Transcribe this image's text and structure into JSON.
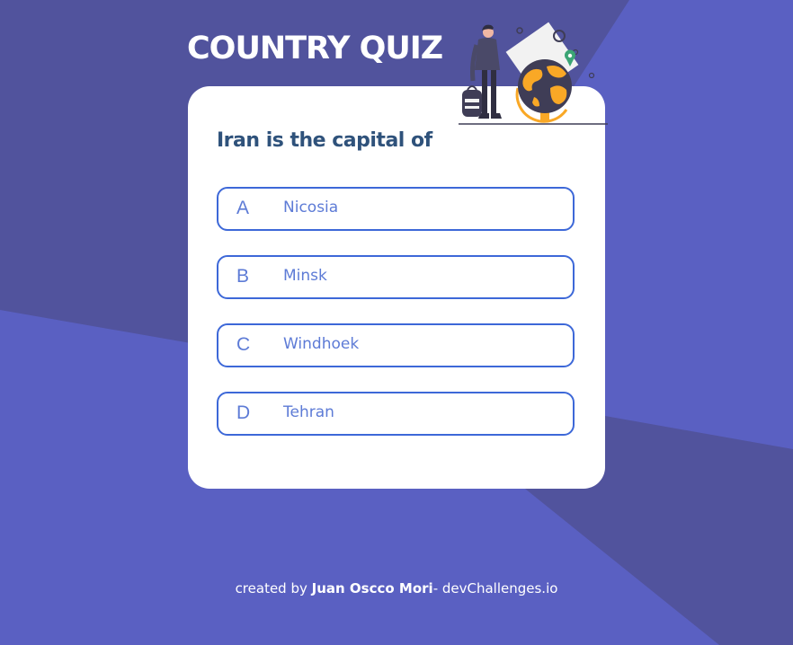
{
  "header": {
    "title": "COUNTRY QUIZ"
  },
  "quiz": {
    "question": "Iran is the capital of",
    "options": [
      {
        "letter": "A",
        "text": "Nicosia"
      },
      {
        "letter": "B",
        "text": "Minsk"
      },
      {
        "letter": "C",
        "text": "Windhoek"
      },
      {
        "letter": "D",
        "text": "Tehran"
      }
    ]
  },
  "footer": {
    "prefix": "created by ",
    "author": "Juan Oscco Mori",
    "suffix": "- devChallenges.io"
  },
  "colors": {
    "background_light": "#5a60c2",
    "background_dark": "#51539d",
    "option_border": "#3d68d8",
    "question_text": "#2f527b",
    "option_text": "#5d7bd6"
  },
  "icons": {
    "illustration": "adventure-globe-illustration"
  }
}
